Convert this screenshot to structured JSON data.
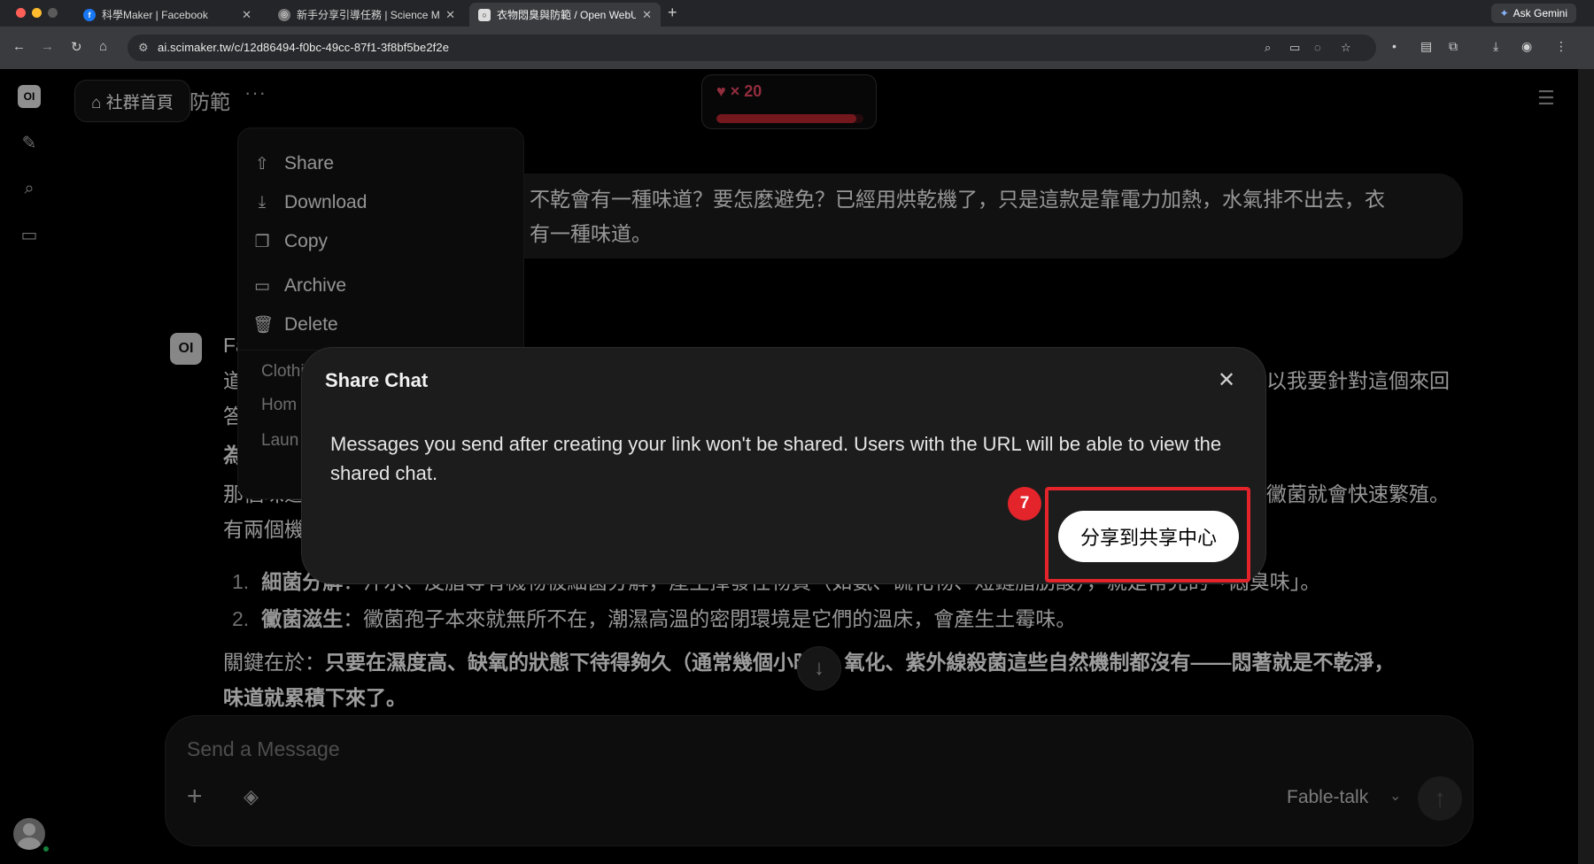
{
  "browser": {
    "tabs": [
      {
        "title": "科學Maker | Facebook",
        "active": false
      },
      {
        "title": "新手分享引導任務 | Science M",
        "active": false
      },
      {
        "title": "衣物悶臭與防範 / Open WebUI",
        "active": true
      }
    ],
    "new_tab": "+",
    "ask_gemini": "Ask Gemini",
    "url": "ai.scimaker.tw/c/12d86494-f0bc-49cc-87f1-3f8bf5be2f2e"
  },
  "app": {
    "logo": "OI",
    "community_button": "⌂ 社群首頁",
    "chat_title_fragment": "防範",
    "more": "···",
    "hearts": {
      "label": "♥ × 20",
      "count": 20,
      "fill_fraction": 0.95,
      "color": "#e0455e"
    },
    "user_message": [
      "不乾會有一種味道？要怎麼避免？已經用烘乾機了，只是這款是靠電力加熱，水氣排不出去，衣",
      "有一種味道。"
    ],
    "assistant": {
      "avatar": "OI",
      "name_fragment": "Fa",
      "line1_left": "道",
      "line1_right": "以我要針對這個來回",
      "line2_left": "答",
      "heading_fragment": "為什麼",
      "para_left": "那個味道",
      "para_right": "黴菌就會快速繁殖。",
      "para2_left": "有兩個機",
      "list": [
        {
          "num": "1.",
          "bold": "細菌分解",
          "text": "：汗水、皮脂等有機物被細菌分解，產生揮發性物質（如氨、硫化物、短鏈脂肪酸），就是常見的「悶臭味」。"
        },
        {
          "num": "2.",
          "bold": "黴菌滋生",
          "text": "：黴菌孢子本來就無所不在，潮濕高溫的密閉環境是它們的溫床，會產生土霉味。"
        }
      ],
      "key_label": "關鍵在於：",
      "key_bold": "只要在濕度高、缺氧的狀態下待得夠久（通常幾個小時），氧化、紫外線殺菌這些自然機制都沒有——悶著就是不乾淨，",
      "key_bold2": "味道就累積下來了。"
    },
    "composer": {
      "placeholder": "Send a Message",
      "model": "Fable-talk"
    }
  },
  "menu": {
    "items": [
      {
        "icon": "upload-icon",
        "glyph": "⇧",
        "label": "Share"
      },
      {
        "icon": "download-icon",
        "glyph": "⤓",
        "label": "Download"
      },
      {
        "icon": "copy-icon",
        "glyph": "❐",
        "label": "Copy"
      },
      {
        "icon": "archive-icon",
        "glyph": "▭",
        "label": "Archive"
      },
      {
        "icon": "trash-icon",
        "glyph": "🗑",
        "label": "Delete"
      }
    ],
    "tags": [
      "Clothin",
      "Hom",
      "Laun"
    ]
  },
  "modal": {
    "title": "Share Chat",
    "body": "Messages you send after creating your link won't be shared. Users with the URL will be able to view the shared chat.",
    "button": "分享到共享中心",
    "step_badge": "7",
    "highlight_color": "#e3242b"
  }
}
